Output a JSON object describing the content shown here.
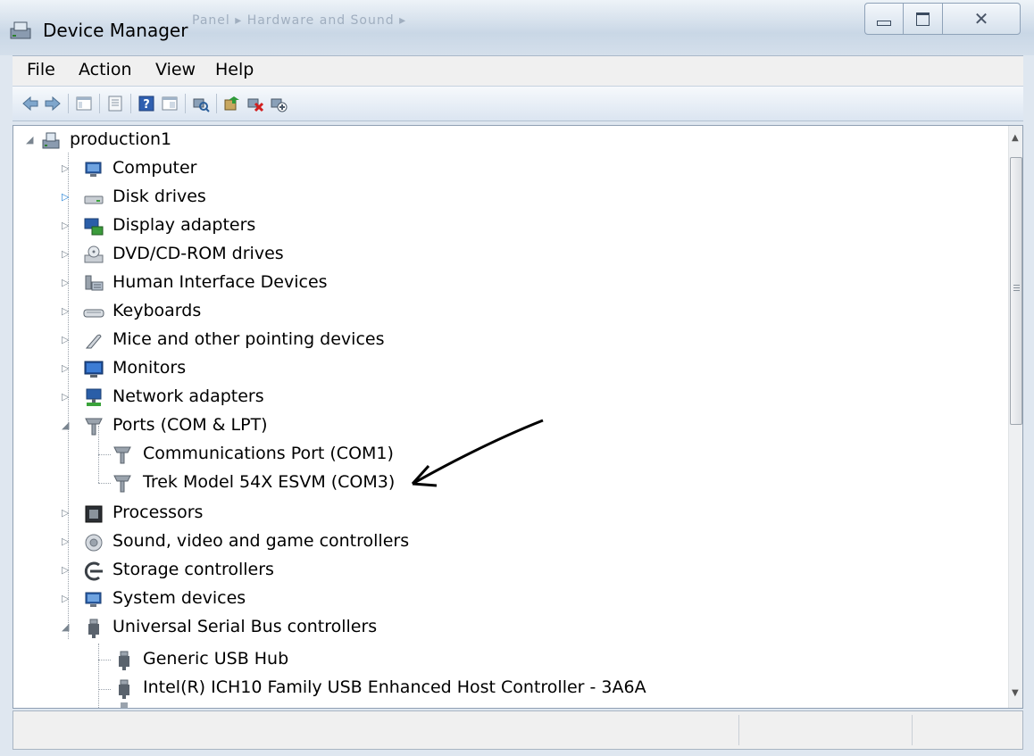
{
  "window": {
    "title": "Device Manager",
    "ghost_breadcrumb": "Panel  ▸  Hardware and Sound  ▸"
  },
  "menu": {
    "file": "File",
    "action": "Action",
    "view": "View",
    "help": "Help"
  },
  "toolbar": {
    "buttons": [
      "back-icon",
      "forward-icon",
      "show-hide-console-tree-icon",
      "properties-icon",
      "help-icon",
      "details-icon",
      "scan-hardware-icon",
      "update-driver-icon",
      "uninstall-icon",
      "disable-icon"
    ]
  },
  "tree": {
    "root": "production1",
    "categories": {
      "computer": "Computer",
      "disk": "Disk drives",
      "display": "Display adapters",
      "dvd": "DVD/CD-ROM drives",
      "hid": "Human Interface Devices",
      "keyboards": "Keyboards",
      "mice": "Mice and other pointing devices",
      "monitors": "Monitors",
      "network": "Network adapters",
      "ports": "Ports (COM & LPT)",
      "processors": "Processors",
      "sound": "Sound, video and game controllers",
      "storage": "Storage controllers",
      "system": "System devices",
      "usb": "Universal Serial Bus controllers"
    },
    "ports_children": {
      "com1": "Communications Port (COM1)",
      "com3": "Trek Model 54X ESVM (COM3)"
    },
    "usb_children": {
      "hub": "Generic USB Hub",
      "ich10": "Intel(R) ICH10 Family USB Enhanced Host Controller - 3A6A"
    }
  },
  "colors": {
    "titlebar": "#c9d7e6",
    "accent": "#1e7fd6"
  }
}
